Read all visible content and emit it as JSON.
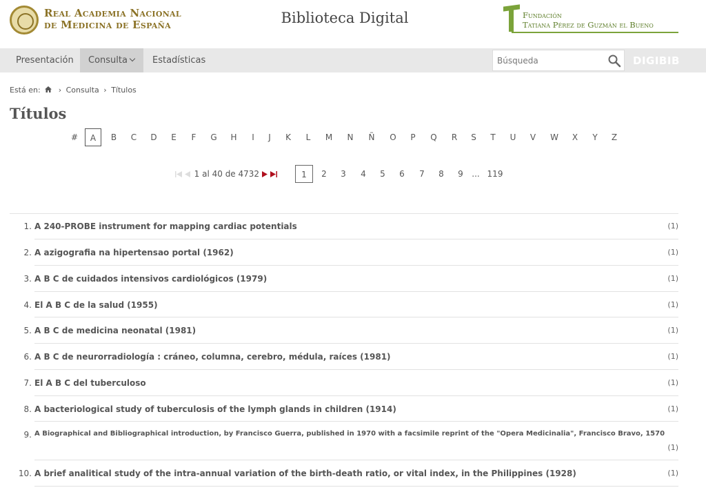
{
  "header": {
    "academy_line1": "Real Academia Nacional",
    "academy_line2": "de Medicina de España",
    "site_title": "Biblioteca Digital",
    "foundation_line1": "Fundación",
    "foundation_line2": "Tatiana Pérez de Guzmán el Bueno"
  },
  "nav": {
    "items": [
      {
        "label": "Presentación"
      },
      {
        "label": "Consulta"
      },
      {
        "label": "Estadísticas"
      }
    ],
    "search_placeholder": "Búsqueda",
    "digibib": "DIGIBIB"
  },
  "breadcrumb": {
    "prefix": "Está en:",
    "crumb1": "Consulta",
    "crumb2": "Títulos"
  },
  "page_title": "Títulos",
  "alphabet": [
    "#",
    "A",
    "B",
    "C",
    "D",
    "E",
    "F",
    "G",
    "H",
    "I",
    "J",
    "K",
    "L",
    "M",
    "N",
    "Ñ",
    "O",
    "P",
    "Q",
    "R",
    "S",
    "T",
    "U",
    "V",
    "W",
    "X",
    "Y",
    "Z"
  ],
  "alphabet_selected": "A",
  "pagination": {
    "range_text": "1 al 40 de 4732",
    "pages": [
      "1",
      "2",
      "3",
      "4",
      "5",
      "6",
      "7",
      "8",
      "9",
      "...",
      "119"
    ],
    "current": "1"
  },
  "results": [
    {
      "num": "1.",
      "title": "A 240-PROBE instrument for mapping cardiac potentials",
      "count": "(1)"
    },
    {
      "num": "2.",
      "title": "A azigografia na hipertensao portal (1962)",
      "count": "(1)"
    },
    {
      "num": "3.",
      "title": "A B C de cuidados intensivos cardiológicos (1979)",
      "count": "(1)"
    },
    {
      "num": "4.",
      "title": "El A B C de la salud (1955)",
      "count": "(1)"
    },
    {
      "num": "5.",
      "title": "A B C de medicina neonatal (1981)",
      "count": "(1)"
    },
    {
      "num": "6.",
      "title": "A B C de neurorradiología : cráneo, columna, cerebro, médula, raíces (1981)",
      "count": "(1)"
    },
    {
      "num": "7.",
      "title": "El A B C del tuberculoso",
      "count": "(1)"
    },
    {
      "num": "8.",
      "title": "A bacteriological study of tuberculosis of the lymph glands in children (1914)",
      "count": "(1)"
    },
    {
      "num": "9.",
      "title": "A Biographical and Bibliographical introduction, by Francisco Guerra, published in 1970 with a facsimile reprint of the \"Opera Medicinalia\", Francisco Bravo, 1570",
      "count": "(1)"
    },
    {
      "num": "10.",
      "title": "A brief analitical study of the intra-annual variation of the birth-death ratio, or vital index, in the Philippines (1928)",
      "count": "(1)"
    }
  ],
  "colors": {
    "academy_gold": "#8b7226",
    "foundation_green": "#7ba33a",
    "nav_bg": "#e8e8e8",
    "pager_arrow_red": "#b0101e"
  }
}
